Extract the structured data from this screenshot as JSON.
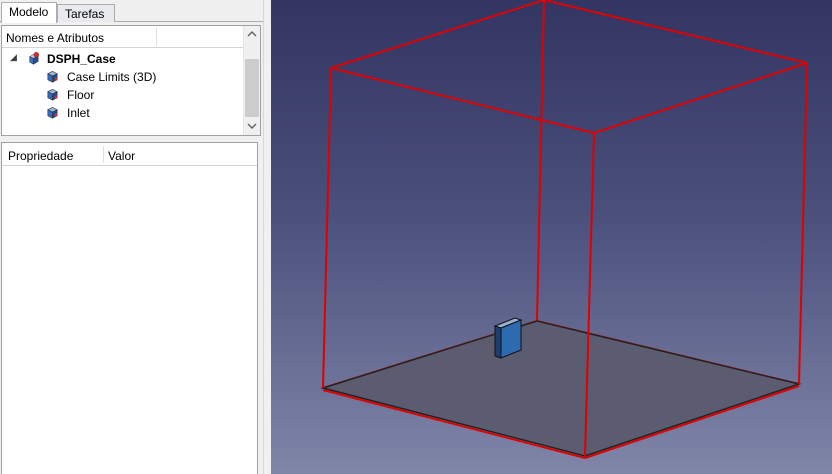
{
  "tabs": [
    {
      "label": "Modelo",
      "active": true
    },
    {
      "label": "Tarefas",
      "active": false
    }
  ],
  "tree": {
    "header": "Nomes e Atributos",
    "root": {
      "label": "DSPH_Case",
      "expanded": true,
      "icon": "document-icon"
    },
    "children": [
      {
        "label": "Case Limits (3D)",
        "icon": "cube-icon"
      },
      {
        "label": "Floor",
        "icon": "cube-icon"
      },
      {
        "label": "Inlet",
        "icon": "cube-icon"
      }
    ]
  },
  "properties": {
    "columns": [
      "Propriedade",
      "Valor"
    ]
  },
  "viewport": {
    "background_top": "#333562",
    "background_bottom": "#8086a8",
    "bbox_color": "#e00000",
    "floor_color": "#5c5c70",
    "inlet_color": "#2d6ab0"
  }
}
